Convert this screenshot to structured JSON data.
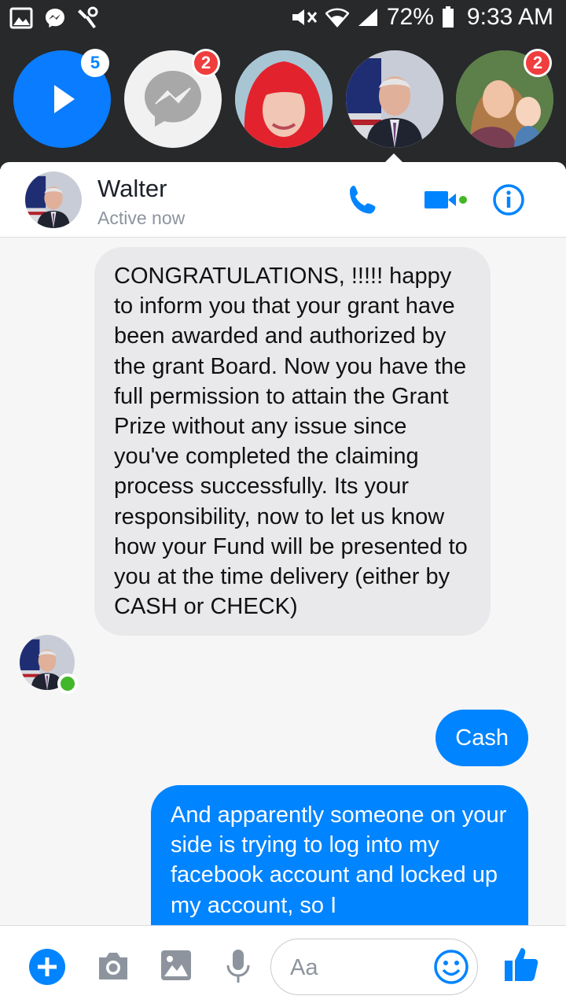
{
  "status_bar": {
    "battery_percent": "72%",
    "time": "9:33 AM"
  },
  "chat_heads": [
    {
      "name": "video-chat-head",
      "badge": "5"
    },
    {
      "name": "messenger-chat-head",
      "badge": "2"
    },
    {
      "name": "contact-chat-head-red-hair",
      "badge": ""
    },
    {
      "name": "contact-chat-head-walter",
      "badge": ""
    },
    {
      "name": "contact-chat-head-mother-baby",
      "badge": "2"
    }
  ],
  "header": {
    "contact_name": "Walter",
    "status": "Active now"
  },
  "messages": {
    "incoming_1": "CONGRATULATIONS, !!!!! happy to inform you that your grant have been awarded and authorized by the grant Board. Now you have the full permission to attain the Grant Prize without any issue since you've completed the claiming process successfully. Its your responsibility, now to let us know how your Fund will be presented to you at the time delivery (either by CASH or CHECK)",
    "outgoing_1": "Cash",
    "outgoing_2": "And apparently someone on your side is trying to log into my facebook account and locked up my account,  so I"
  },
  "composer": {
    "placeholder": "Aa"
  },
  "colors": {
    "accent": "#0084ff",
    "badge_red": "#f03d3d",
    "online_green": "#42b72a",
    "incoming_bubble": "#e9e9eb"
  }
}
